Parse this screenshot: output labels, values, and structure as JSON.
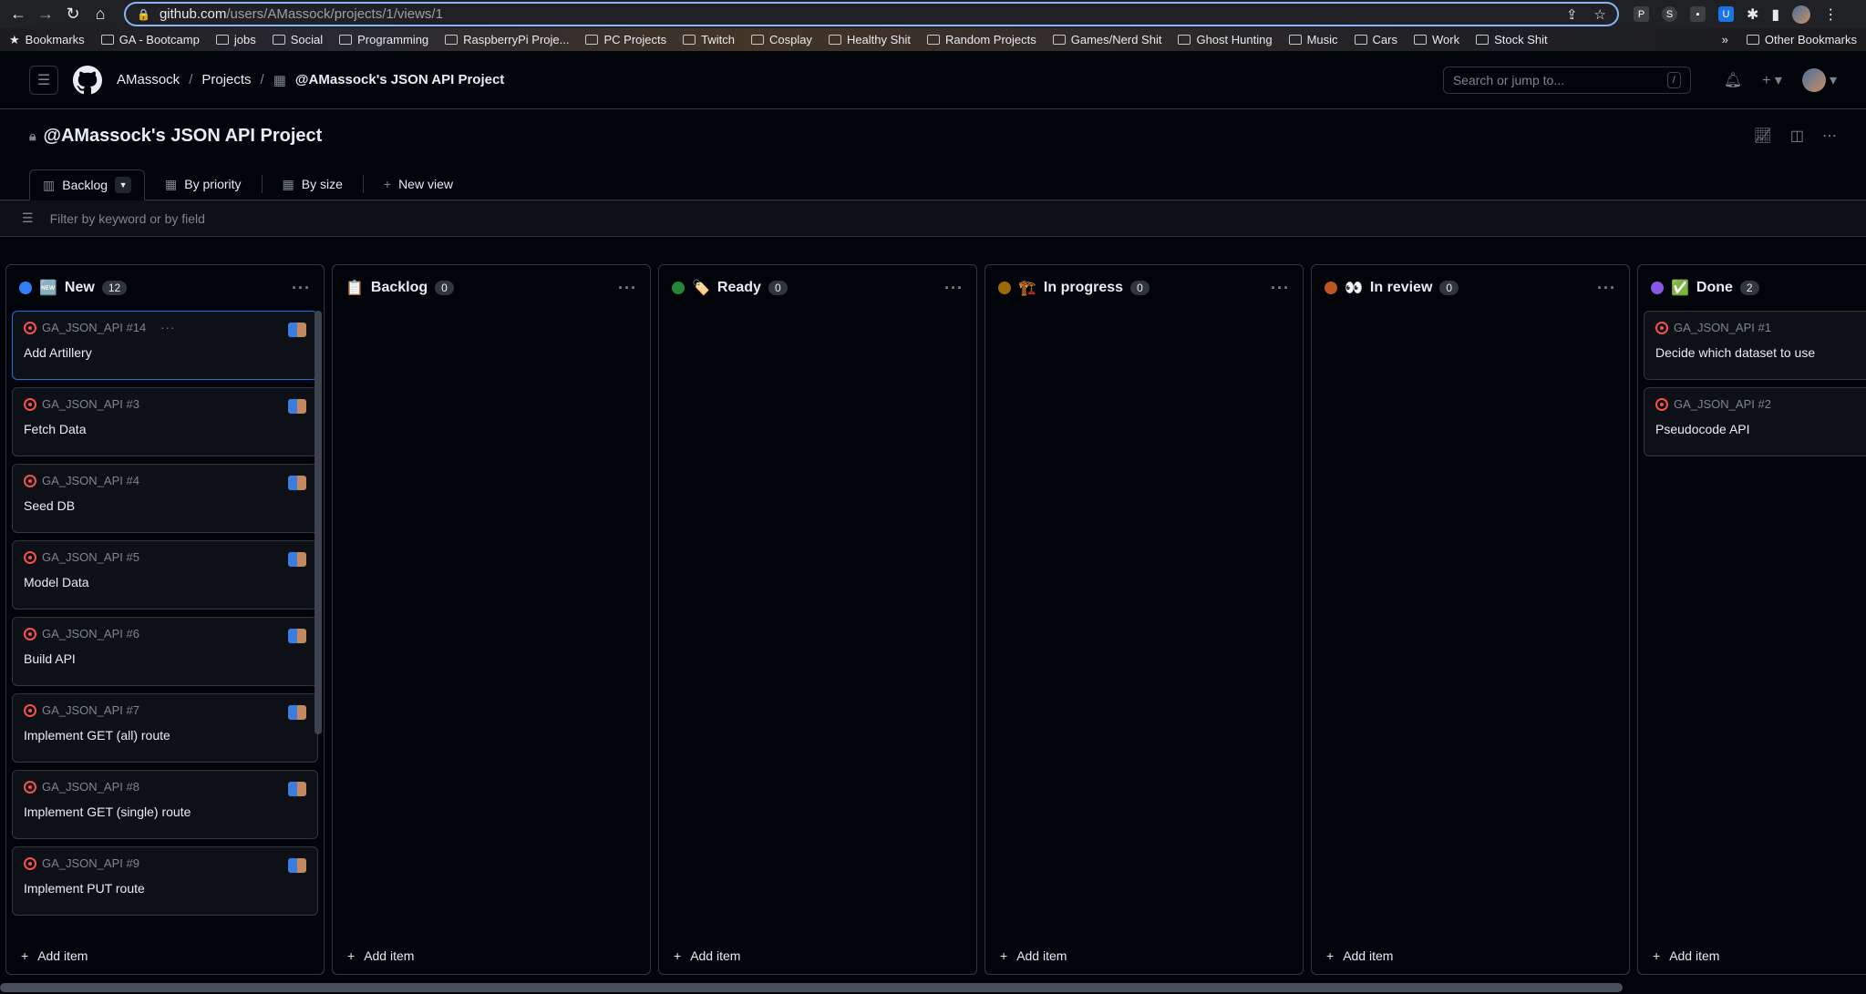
{
  "browser": {
    "url_host": "github.com",
    "url_path": "/users/AMassock/projects/1/views/1",
    "bookmarks_label": "Bookmarks",
    "bookmarks": [
      "GA - Bootcamp",
      "jobs",
      "Social",
      "Programming",
      "RaspberryPi Proje...",
      "PC Projects",
      "Twitch",
      "Cosplay",
      "Healthy Shit",
      "Random Projects",
      "Games/Nerd Shit",
      "Ghost Hunting",
      "Music",
      "Cars",
      "Work",
      "Stock Shit"
    ],
    "overflow": "»",
    "other_bookmarks": "Other Bookmarks"
  },
  "header": {
    "breadcrumb": [
      "AMassock",
      "Projects",
      "@AMassock's JSON API Project"
    ],
    "search_placeholder": "Search or jump to...",
    "search_kbd": "/"
  },
  "project": {
    "title": "@AMassock's JSON API Project"
  },
  "views": {
    "tabs": [
      "Backlog",
      "By priority",
      "By size"
    ],
    "new_view": "New view",
    "filter_placeholder": "Filter by keyword or by field"
  },
  "add_item_label": "Add item",
  "columns": [
    {
      "name": "New",
      "emoji": "🆕",
      "color": "#2f81f7",
      "count": "12",
      "cards": [
        {
          "id": "GA_JSON_API #14",
          "title": "Add Artillery"
        },
        {
          "id": "GA_JSON_API #3",
          "title": "Fetch Data"
        },
        {
          "id": "GA_JSON_API #4",
          "title": "Seed DB"
        },
        {
          "id": "GA_JSON_API #5",
          "title": "Model Data"
        },
        {
          "id": "GA_JSON_API #6",
          "title": "Build API"
        },
        {
          "id": "GA_JSON_API #7",
          "title": "Implement GET (all) route"
        },
        {
          "id": "GA_JSON_API #8",
          "title": "Implement GET (single) route"
        },
        {
          "id": "GA_JSON_API #9",
          "title": "Implement PUT route"
        }
      ]
    },
    {
      "name": "Backlog",
      "emoji": "📋",
      "color": "",
      "count": "0",
      "cards": []
    },
    {
      "name": "Ready",
      "emoji": "🏷️",
      "color": "#238636",
      "count": "0",
      "cards": []
    },
    {
      "name": "In progress",
      "emoji": "🏗️",
      "color": "#9e6a03",
      "count": "0",
      "cards": []
    },
    {
      "name": "In review",
      "emoji": "👀",
      "color": "#bd561d",
      "count": "0",
      "cards": []
    },
    {
      "name": "Done",
      "emoji": "✅",
      "color": "#8957e5",
      "count": "2",
      "cards": [
        {
          "id": "GA_JSON_API #1",
          "title": "Decide which dataset to use"
        },
        {
          "id": "GA_JSON_API #2",
          "title": "Pseudocode API"
        }
      ]
    }
  ]
}
